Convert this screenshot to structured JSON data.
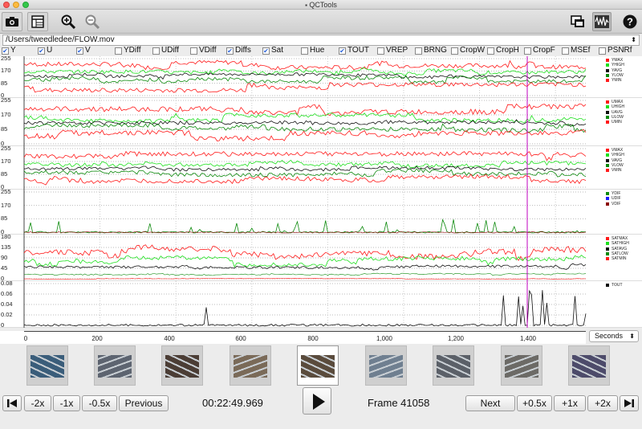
{
  "window": {
    "title": "QCTools"
  },
  "file": {
    "path": "/Users/tweedledee/FLOW.mov"
  },
  "filters": [
    {
      "label": "Y",
      "checked": true
    },
    {
      "label": "U",
      "checked": true
    },
    {
      "label": "V",
      "checked": true
    },
    {
      "label": "YDiff",
      "checked": false
    },
    {
      "label": "UDiff",
      "checked": false
    },
    {
      "label": "VDiff",
      "checked": false
    },
    {
      "label": "Diffs",
      "checked": true
    },
    {
      "label": "Sat",
      "checked": true
    },
    {
      "label": "Hue",
      "checked": false
    },
    {
      "label": "TOUT",
      "checked": true
    },
    {
      "label": "VREP",
      "checked": false
    },
    {
      "label": "BRNG",
      "checked": false
    },
    {
      "label": "CropW",
      "checked": false
    },
    {
      "label": "CropH",
      "checked": false
    },
    {
      "label": "CropF",
      "checked": false
    },
    {
      "label": "MSEf",
      "checked": false
    },
    {
      "label": "PSNRf",
      "checked": false
    }
  ],
  "colors": {
    "red": "#ff1a1a",
    "green": "#1ee01e",
    "dark": "#111111",
    "darkgreen": "#0c8a0c",
    "darkred": "#8a0000",
    "blue": "#1a1aff",
    "cursor": "#c000c0"
  },
  "graphs": [
    {
      "ticks": [
        "255",
        "170",
        "85",
        "0"
      ],
      "legend": [
        [
          "YMAX",
          "red"
        ],
        [
          "YHIGH",
          "green"
        ],
        [
          "YAVG",
          "dark"
        ],
        [
          "YLOW",
          "darkgreen"
        ],
        [
          "YMIN",
          "red"
        ]
      ]
    },
    {
      "ticks": [
        "255",
        "170",
        "85",
        "0"
      ],
      "legend": [
        [
          "UMAX",
          "red"
        ],
        [
          "UHIGH",
          "green"
        ],
        [
          "UAVG",
          "dark"
        ],
        [
          "ULOW",
          "darkgreen"
        ],
        [
          "UMIN",
          "red"
        ]
      ]
    },
    {
      "ticks": [
        "255",
        "170",
        "85",
        "0"
      ],
      "legend": [
        [
          "VMAX",
          "red"
        ],
        [
          "VHIGH",
          "green"
        ],
        [
          "VAVG",
          "dark"
        ],
        [
          "VLOW",
          "darkgreen"
        ],
        [
          "VMIN",
          "red"
        ]
      ]
    },
    {
      "ticks": [
        "255",
        "170",
        "85",
        "0"
      ],
      "legend": [
        [
          "YDIF",
          "darkgreen"
        ],
        [
          "UDIF",
          "blue"
        ],
        [
          "VDIF",
          "darkred"
        ]
      ]
    },
    {
      "ticks": [
        "180",
        "135",
        "90",
        "45",
        "0"
      ],
      "legend": [
        [
          "SATMAX",
          "red"
        ],
        [
          "SATHIGH",
          "green"
        ],
        [
          "SATAVG",
          "dark"
        ],
        [
          "SATLOW",
          "darkgreen"
        ],
        [
          "SATMIN",
          "red"
        ]
      ]
    },
    {
      "ticks": [
        "0.08",
        "0.06",
        "0.04",
        "0.02",
        "0"
      ],
      "legend": [
        [
          "TOUT",
          "dark"
        ]
      ]
    }
  ],
  "xaxis": {
    "labels": [
      "0",
      "200",
      "400",
      "600",
      "800",
      "1,000",
      "1,200",
      "1,400"
    ],
    "units": "Seconds"
  },
  "playback": {
    "timecode": "00:22:49.969",
    "frame": "Frame 41058",
    "buttons": {
      "m2x": "-2x",
      "m1x": "-1x",
      "m05x": "-0.5x",
      "previous": "Previous",
      "next": "Next",
      "p05x": "+0.5x",
      "p1x": "+1x",
      "p2x": "+2x"
    }
  },
  "thumbnails": [
    "thumb-1",
    "thumb-2",
    "thumb-3",
    "thumb-4",
    "thumb-5",
    "thumb-6",
    "thumb-7",
    "thumb-8",
    "thumb-9"
  ]
}
